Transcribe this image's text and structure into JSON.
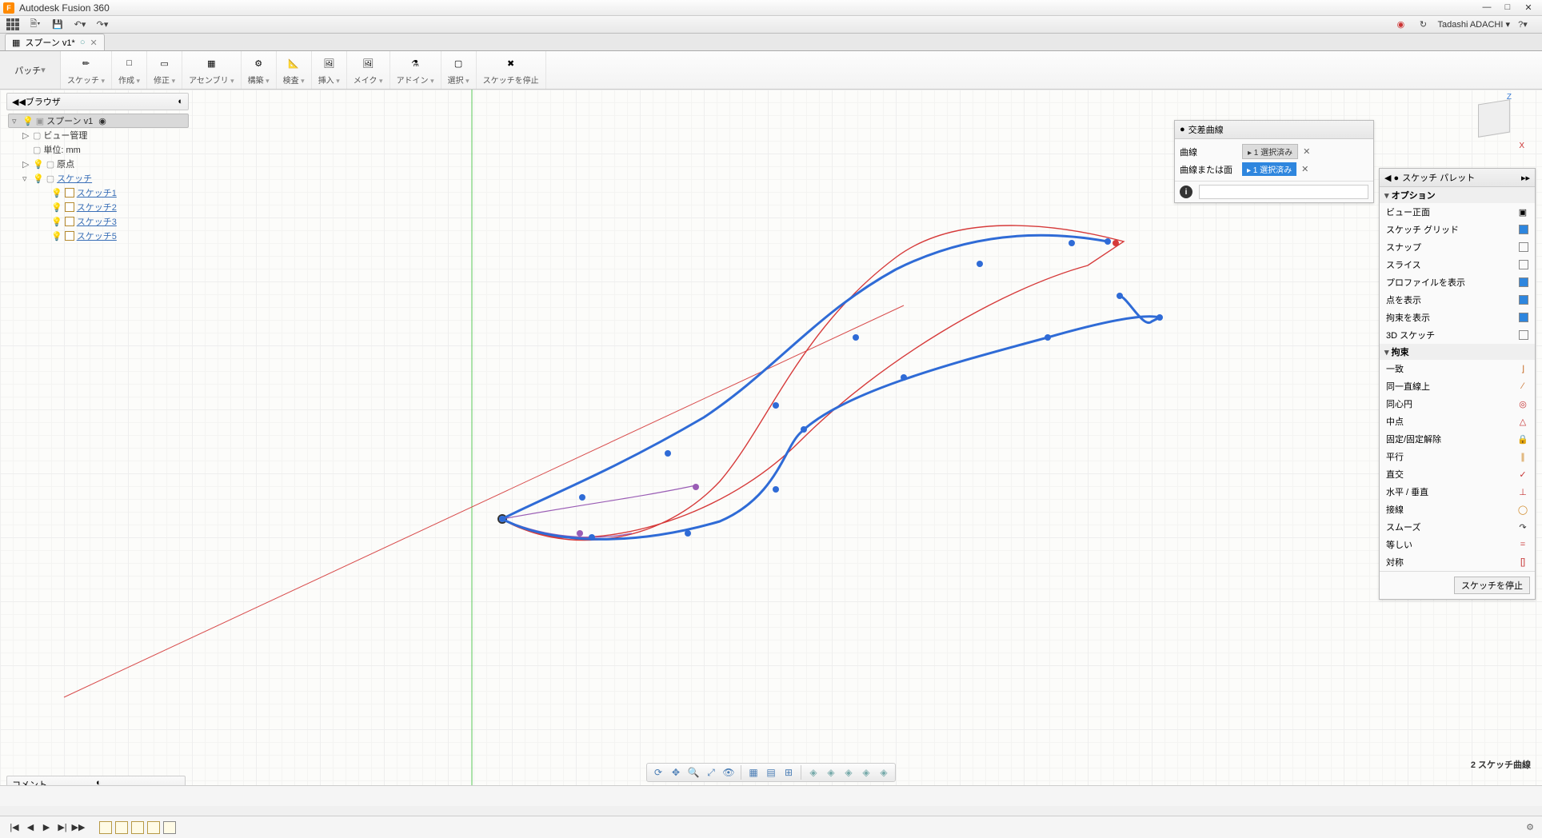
{
  "app": {
    "title": "Autodesk Fusion 360",
    "logo_letter": "F"
  },
  "user": {
    "name": "Tadashi ADACHI"
  },
  "doc_tab": {
    "name": "スプーン v1*",
    "modified": "○"
  },
  "workspace": "パッチ",
  "ribbon": [
    {
      "label": "スケッチ",
      "dropdown": true
    },
    {
      "label": "作成",
      "dropdown": true
    },
    {
      "label": "修正",
      "dropdown": true
    },
    {
      "label": "アセンブリ",
      "dropdown": true
    },
    {
      "label": "構築",
      "dropdown": true
    },
    {
      "label": "検査",
      "dropdown": true
    },
    {
      "label": "挿入",
      "dropdown": true
    },
    {
      "label": "メイク",
      "dropdown": true
    },
    {
      "label": "アドイン",
      "dropdown": true
    },
    {
      "label": "選択",
      "dropdown": true
    },
    {
      "label": "スケッチを停止",
      "dropdown": false
    }
  ],
  "browser": {
    "title": "ブラウザ",
    "root": "スプーン v1",
    "nodes": [
      {
        "label": "ビュー管理",
        "icon": "folder",
        "level": 1,
        "expand": "▷"
      },
      {
        "label": "単位: mm",
        "icon": "doc",
        "level": 1,
        "expand": ""
      },
      {
        "label": "原点",
        "icon": "folder",
        "level": 1,
        "expand": "▷",
        "bulb": true
      },
      {
        "label": "スケッチ",
        "icon": "folder",
        "level": 1,
        "expand": "▿",
        "bulb": true
      }
    ],
    "sketches": [
      "スケッチ1",
      "スケッチ2",
      "スケッチ3",
      "スケッチ5"
    ]
  },
  "comment_bar": "コメント",
  "dialog": {
    "title": "交差曲線",
    "rows": [
      {
        "label": "曲線",
        "chip": "1 選択済み",
        "style": "gray"
      },
      {
        "label": "曲線または面",
        "chip": "1 選択済み",
        "style": "blue"
      }
    ]
  },
  "palette": {
    "title": "スケッチ パレット",
    "sections": [
      {
        "name": "オプション",
        "items": [
          {
            "label": "ビュー正面",
            "type": "btn"
          },
          {
            "label": "スケッチ グリッド",
            "type": "check",
            "on": true
          },
          {
            "label": "スナップ",
            "type": "check",
            "on": false
          },
          {
            "label": "スライス",
            "type": "check",
            "on": false
          },
          {
            "label": "プロファイルを表示",
            "type": "check",
            "on": true
          },
          {
            "label": "点を表示",
            "type": "check",
            "on": true
          },
          {
            "label": "拘束を表示",
            "type": "check",
            "on": true
          },
          {
            "label": "3D スケッチ",
            "type": "check",
            "on": false
          }
        ]
      },
      {
        "name": "拘束",
        "items": [
          {
            "label": "一致",
            "type": "glyph",
            "glyph": "⌋",
            "color": "#c66b25"
          },
          {
            "label": "同一直線上",
            "type": "glyph",
            "glyph": "⁄",
            "color": "#c66b25"
          },
          {
            "label": "同心円",
            "type": "glyph",
            "glyph": "◎",
            "color": "#c53030"
          },
          {
            "label": "中点",
            "type": "glyph",
            "glyph": "△",
            "color": "#c53030"
          },
          {
            "label": "固定/固定解除",
            "type": "glyph",
            "glyph": "🔒",
            "color": "#d08a2a"
          },
          {
            "label": "平行",
            "type": "glyph",
            "glyph": "∥",
            "color": "#d08a2a"
          },
          {
            "label": "直交",
            "type": "glyph",
            "glyph": "✓",
            "color": "#c53030"
          },
          {
            "label": "水平 / 垂直",
            "type": "glyph",
            "glyph": "⊥",
            "color": "#c53030"
          },
          {
            "label": "接線",
            "type": "glyph",
            "glyph": "◯",
            "color": "#d08a2a"
          },
          {
            "label": "スムーズ",
            "type": "glyph",
            "glyph": "↷",
            "color": "#333"
          },
          {
            "label": "等しい",
            "type": "glyph",
            "glyph": "=",
            "color": "#c53030"
          },
          {
            "label": "対称",
            "type": "glyph",
            "glyph": "[]",
            "color": "#c53030"
          }
        ]
      }
    ],
    "footer_button": "スケッチを停止"
  },
  "status_right": "2 スケッチ曲線",
  "viewcube": {
    "z": "Z",
    "x": "X"
  }
}
